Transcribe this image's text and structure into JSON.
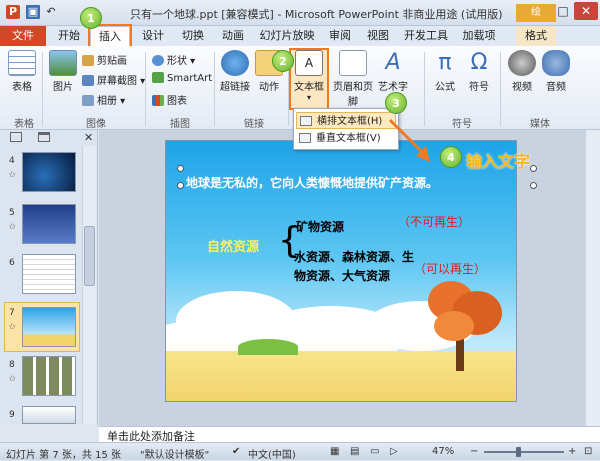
{
  "window": {
    "title": "只有一个地球.ppt [兼容模式] - Microsoft PowerPoint 非商业用途 (试用版)",
    "minimize": "─",
    "maximize": "□",
    "close": "✕",
    "app_icon": "P"
  },
  "quick_access": {
    "save_icon": "▣",
    "undo_icon": "↶"
  },
  "tabs": [
    {
      "label": "文件"
    },
    {
      "label": "开始"
    },
    {
      "label": "插入"
    },
    {
      "label": "设计"
    },
    {
      "label": "切换"
    },
    {
      "label": "动画"
    },
    {
      "label": "幻灯片放映"
    },
    {
      "label": "审阅"
    },
    {
      "label": "视图"
    },
    {
      "label": "开发工具"
    },
    {
      "label": "加载项"
    },
    {
      "label": "格式"
    }
  ],
  "contextual_tab": "绘",
  "ribbon": {
    "table": "表格",
    "picture": "图片",
    "clipart": "剪贴画",
    "screenshot": "屏幕截图",
    "album": "相册",
    "shapes": "形状",
    "smartart": "SmartArt",
    "chart": "图表",
    "hyperlink": "超链接",
    "action": "动作",
    "textbox": "文本框",
    "header_footer": "页眉和页脚",
    "wordart": "艺术字",
    "equation": "公式",
    "symbol": "符号",
    "video": "视频",
    "audio": "音频",
    "groups": {
      "tables": "表格",
      "images": "图像",
      "illustrations": "插图",
      "links": "链接",
      "symbols": "符号",
      "media": "媒体"
    }
  },
  "textbox_menu": [
    {
      "label": "横排文本框(H)"
    },
    {
      "label": "垂直文本框(V)"
    }
  ],
  "thumbnails": [
    {
      "num": "4"
    },
    {
      "num": "5"
    },
    {
      "num": "6"
    },
    {
      "num": "7"
    },
    {
      "num": "8"
    },
    {
      "num": "9"
    }
  ],
  "slide": {
    "title": "地球是无私的，它向人类慷慨地提供矿产资源。",
    "natural": "自然资源",
    "mineral": "矿物资源",
    "nonrenewable": "（不可再生）",
    "renewable_list": "水资源、森林资源、生物资源、大气资源",
    "renewable": "（可以再生）",
    "brace": "{"
  },
  "callouts": {
    "step1": "1",
    "step2": "2",
    "step3": "3",
    "step4": "4",
    "input_text": "输入文字"
  },
  "notes": "单击此处添加备注",
  "status": {
    "slide_pos": "幻灯片 第 7 张，共 15 张",
    "theme": "\"默认设计模板\"",
    "language": "中文(中国)",
    "zoom": "47%"
  },
  "colors": {
    "accent_orange": "#f07a24",
    "file_tab": "#d24726",
    "badge_green": "#62b22b"
  }
}
